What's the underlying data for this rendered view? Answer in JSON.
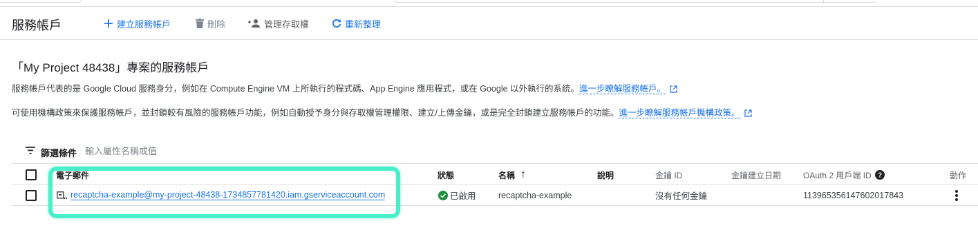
{
  "toolbar": {
    "title": "服務帳戶",
    "create_label": "建立服務帳戶",
    "delete_label": "刪除",
    "manage_label": "管理存取權",
    "refresh_label": "重新整理"
  },
  "section": {
    "title": "「My Project 48438」專案的服務帳戶",
    "desc1_text": "服務帳戶代表的是 Google Cloud 服務身分，例如在 Compute Engine VM 上所執行的程式碼、App Engine 應用程式，或在 Google 以外執行的系統。",
    "desc1_link": "進一步瞭解服務帳戶。",
    "desc2_text": "可使用機構政策來保護服務帳戶，並封鎖較有風險的服務帳戶功能，例如自動授予身分與存取權管理權限、建立/上傳金鑰，或是完全封鎖建立服務帳戶的功能。",
    "desc2_link": "進一步瞭解服務帳戶機構政策。"
  },
  "filter": {
    "label": "篩選條件",
    "placeholder": "輸入屬性名稱或值"
  },
  "table": {
    "headers": {
      "email": "電子郵件",
      "status": "狀態",
      "name": "名稱",
      "sort_arrow": "↑",
      "description": "說明",
      "key_id": "金鑰 ID",
      "key_created": "金鑰建立日期",
      "oauth_id": "OAuth 2 用戶端 ID",
      "actions": "動作"
    },
    "rows": [
      {
        "email": "recaptcha-example@my-project-48438-1734857781420.iam.gserviceaccount.com",
        "status": "已啟用",
        "name": "recaptcha-example",
        "description": "",
        "key_id": "沒有任何金鑰",
        "key_created": "",
        "oauth_id": "113965356147602017843"
      }
    ]
  },
  "icons": {
    "create": "plus-icon",
    "delete": "trash-icon",
    "manage": "person-add-icon",
    "refresh": "refresh-icon",
    "filter": "filter-list-icon",
    "help": "help-circle-icon",
    "status": "check-circle-icon",
    "row": "service-account-key-icon",
    "more": "more-vert-icon",
    "external": "external-link-icon"
  },
  "colors": {
    "link": "#1a73e8",
    "success": "#1e8e3e",
    "highlight": "#47f0c9"
  }
}
